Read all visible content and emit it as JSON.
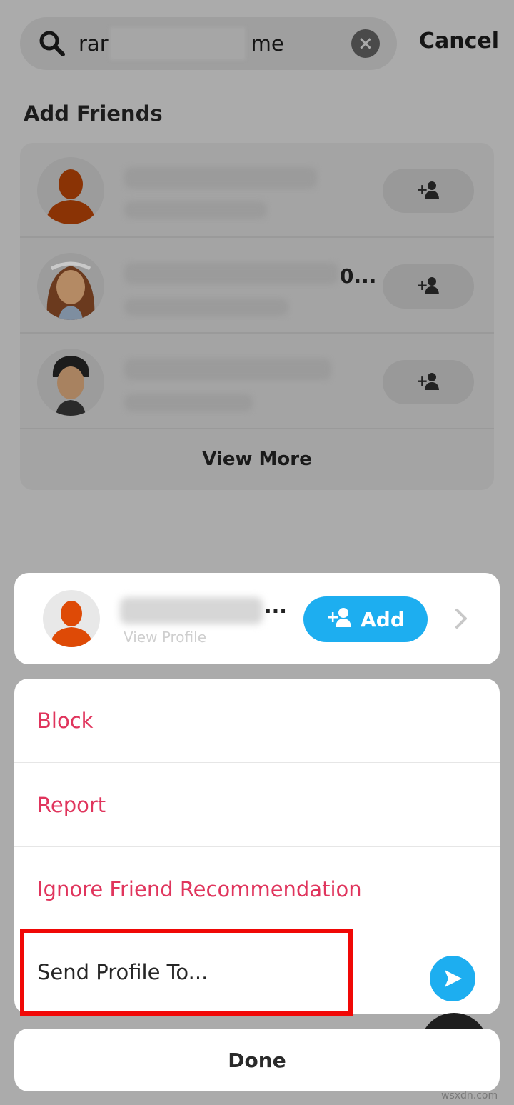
{
  "search": {
    "query_visible": "rar",
    "query_tail": "me",
    "clear_symbol": "×"
  },
  "header": {
    "cancel_label": "Cancel"
  },
  "section": {
    "title": "Add Friends"
  },
  "friends": {
    "rows": [
      {
        "avatar": "silhouette-avatar",
        "add_icon": "+👤"
      },
      {
        "avatar": "female-bitmoji-avatar",
        "truncated_text": "0...",
        "add_icon": "+👤"
      },
      {
        "avatar": "male-bitmoji-avatar",
        "add_icon": "+👤"
      }
    ],
    "view_more_label": "View More"
  },
  "profile": {
    "name_suffix": "...",
    "subtitle": "View Profile",
    "add_label": "Add"
  },
  "menu": {
    "items": [
      {
        "label": "Block",
        "color": "#e0355d"
      },
      {
        "label": "Report",
        "color": "#e0355d"
      },
      {
        "label": "Ignore Friend Recommendation",
        "color": "#e0355d"
      },
      {
        "label": "Send Profile To...",
        "color": "#262626"
      }
    ]
  },
  "done_label": "Done",
  "watermark": "wsxdn.com",
  "colors": {
    "accent": "#1daef0",
    "destructive": "#e0355d",
    "highlight": "#f00806"
  }
}
